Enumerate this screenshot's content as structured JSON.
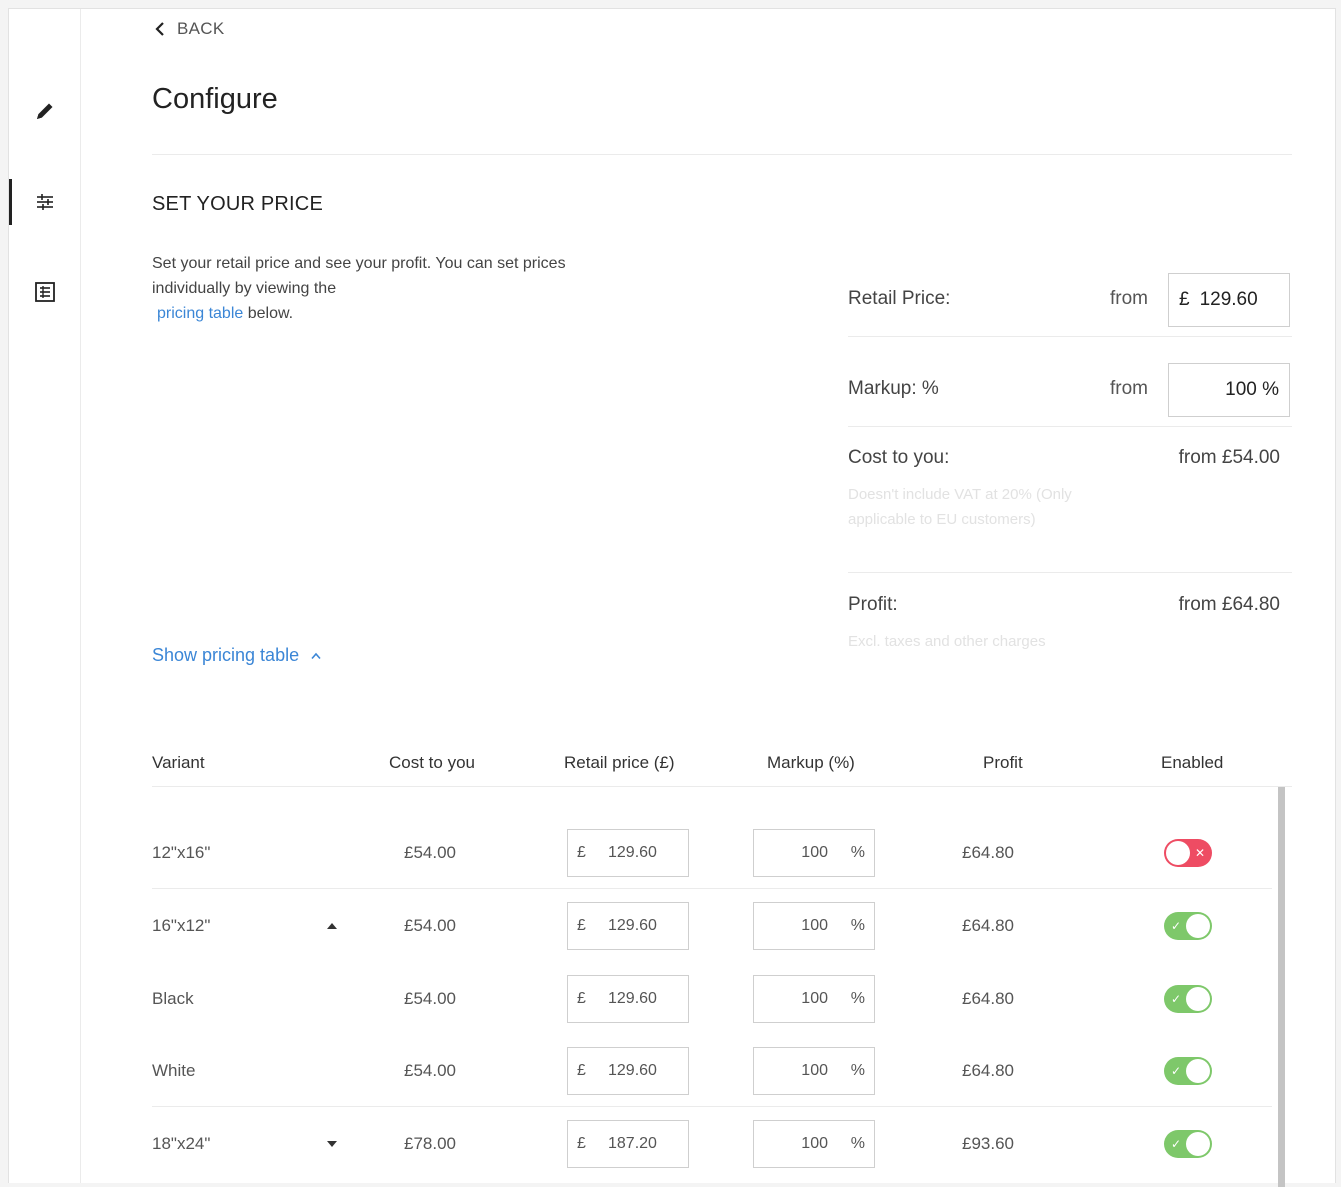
{
  "nav": {
    "back_label": "BACK",
    "rail": [
      {
        "icon": "pencil-icon",
        "active": false
      },
      {
        "icon": "sliders-icon",
        "active": true
      },
      {
        "icon": "table-icon",
        "active": false
      }
    ]
  },
  "page": {
    "title": "Configure",
    "section_title": "SET YOUR PRICE",
    "description_prefix": "Set your retail price and see your profit. You can set prices individually by viewing the",
    "description_link": "pricing table",
    "description_suffix": " below.",
    "show_table_label": "Show pricing table"
  },
  "pricing": {
    "retail_label": "Retail Price:",
    "retail_from": "from",
    "retail_currency": "£",
    "retail_value": "129.60",
    "markup_label": "Markup: %",
    "markup_from": "from",
    "markup_value": "100 %",
    "cost_label": "Cost to you:",
    "cost_value": "from £54.00",
    "cost_note": "Doesn't include VAT at 20% (Only applicable to EU customers)",
    "profit_label": "Profit:",
    "profit_value": "from £64.80",
    "profit_note": "Excl. taxes and other charges"
  },
  "table": {
    "headers": {
      "variant": "Variant",
      "cost": "Cost to you",
      "retail": "Retail price (£)",
      "markup": "Markup (%)",
      "profit": "Profit",
      "enabled": "Enabled"
    },
    "currency_symbol": "£",
    "percent_symbol": "%",
    "rows": [
      {
        "variant": "12\"x16\"",
        "caret": "",
        "cost": "£54.00",
        "retail": "129.60",
        "markup": "100",
        "profit": "£64.80",
        "enabled": false
      },
      {
        "variant": "16\"x12\"",
        "caret": "up",
        "cost": "£54.00",
        "retail": "129.60",
        "markup": "100",
        "profit": "£64.80",
        "enabled": true
      },
      {
        "variant": "Black",
        "caret": "",
        "cost": "£54.00",
        "retail": "129.60",
        "markup": "100",
        "profit": "£64.80",
        "enabled": true
      },
      {
        "variant": "White",
        "caret": "",
        "cost": "£54.00",
        "retail": "129.60",
        "markup": "100",
        "profit": "£64.80",
        "enabled": true
      },
      {
        "variant": "18\"x24\"",
        "caret": "down",
        "cost": "£78.00",
        "retail": "187.20",
        "markup": "100",
        "profit": "£93.60",
        "enabled": true
      }
    ]
  }
}
